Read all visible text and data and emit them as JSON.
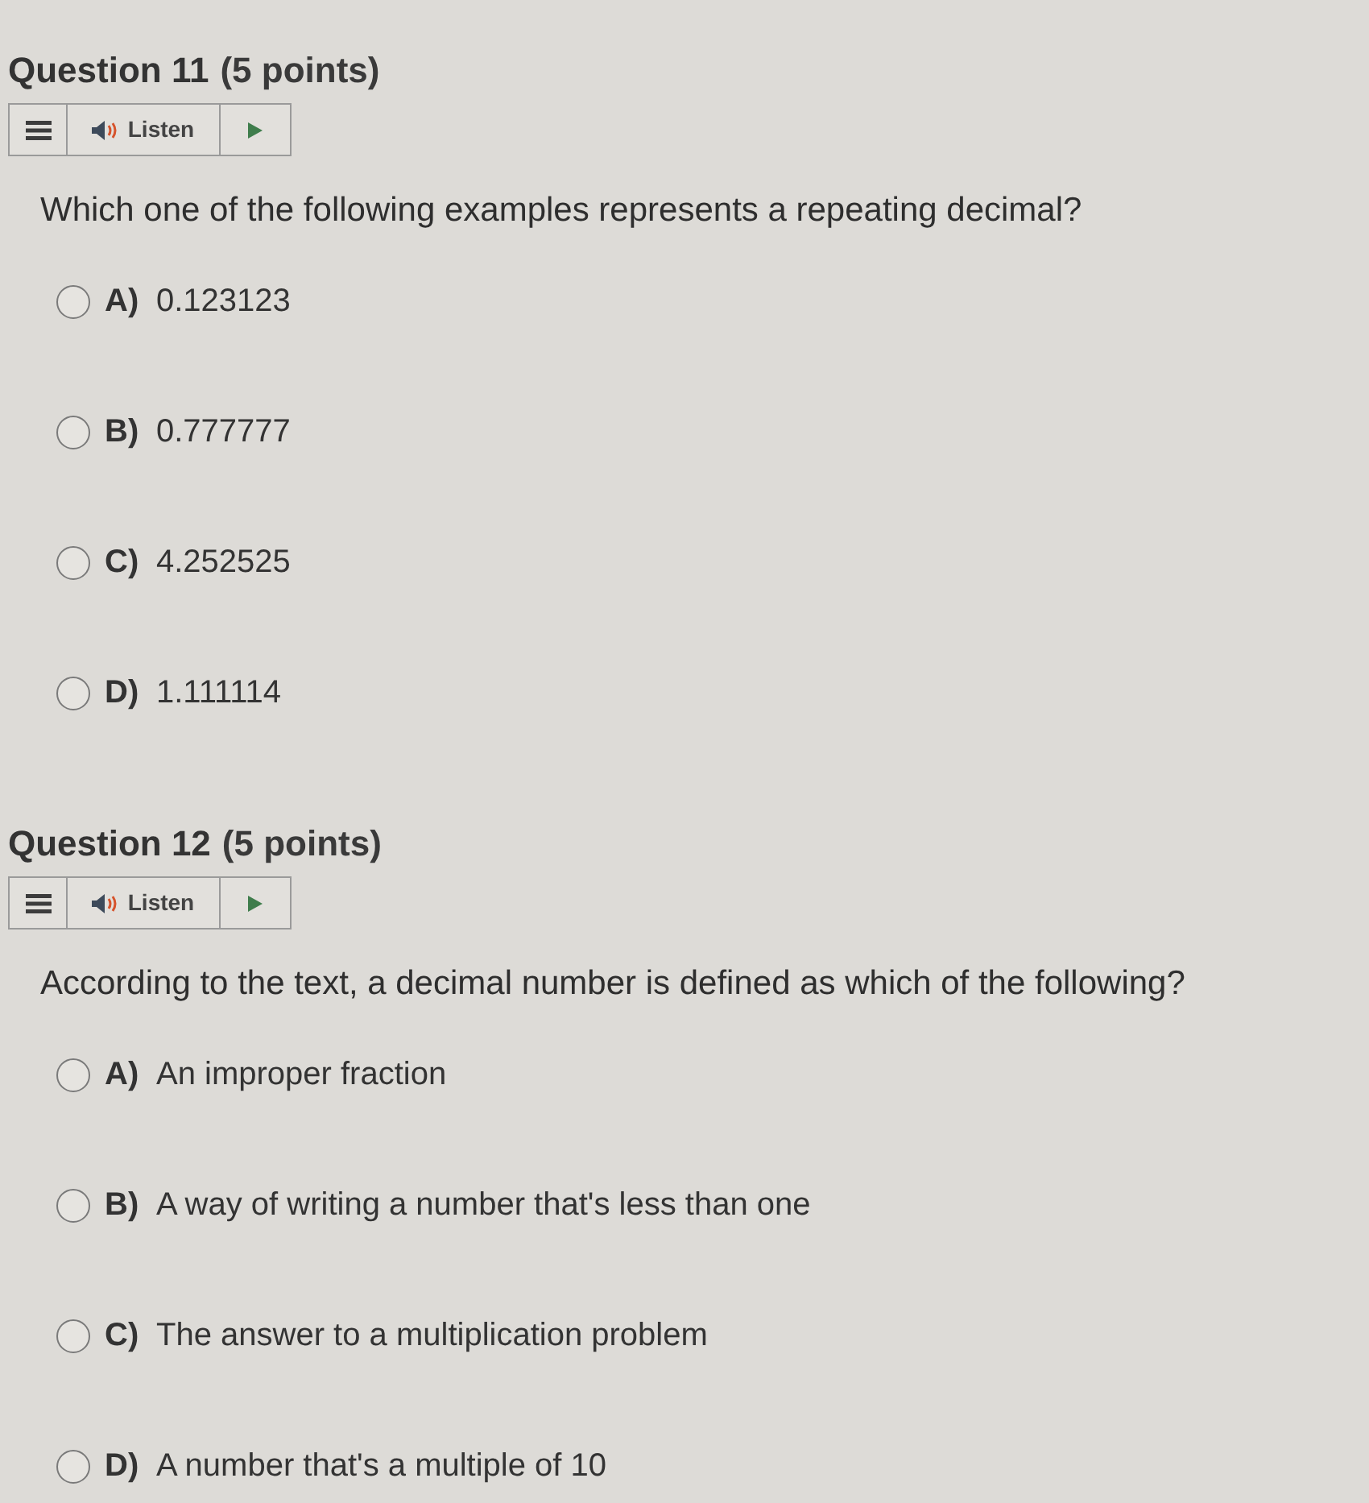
{
  "questions": [
    {
      "title": "Question 11",
      "points": "(5 points)",
      "listen": {
        "label": "Listen"
      },
      "prompt": "Which one of the following examples represents a repeating decimal?",
      "options": [
        {
          "letter": "A)",
          "text": "0.123123",
          "selected": false
        },
        {
          "letter": "B)",
          "text": "0.777777",
          "selected": false
        },
        {
          "letter": "C)",
          "text": "4.252525",
          "selected": false
        },
        {
          "letter": "D)",
          "text": "1.111114",
          "selected": false
        }
      ]
    },
    {
      "title": "Question 12",
      "points": "(5 points)",
      "listen": {
        "label": "Listen"
      },
      "prompt": "According to the text, a decimal number is defined as which of the following?",
      "options": [
        {
          "letter": "A)",
          "text": "An improper fraction",
          "selected": false
        },
        {
          "letter": "B)",
          "text": "A way of writing a number that's less than one",
          "selected": false
        },
        {
          "letter": "C)",
          "text": "The answer to a multiplication problem",
          "selected": false
        },
        {
          "letter": "D)",
          "text": "A number that's a multiple of 10",
          "selected": false
        }
      ]
    }
  ]
}
